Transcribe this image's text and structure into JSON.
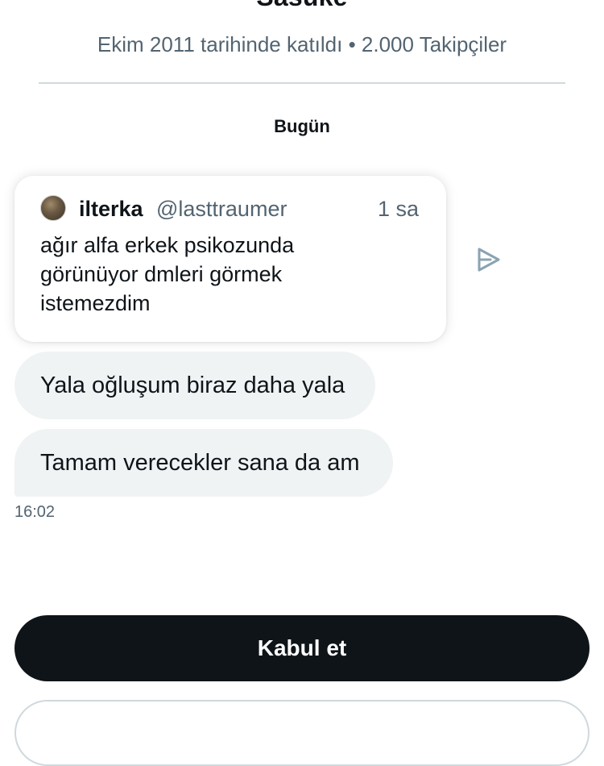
{
  "profile": {
    "name": "Sasuke",
    "meta": "Ekim 2011 tarihinde katıldı • 2.000 Takipçiler"
  },
  "conversation": {
    "day_label": "Bugün",
    "quoted_post": {
      "author_name": "ilterka",
      "author_handle": "@lasttraumer",
      "time": "1 sa",
      "text": "ağır alfa erkek psikozunda görünüyor dmleri görmek istemezdim"
    },
    "messages": [
      {
        "text": "Yala oğluşum biraz daha yala"
      },
      {
        "text": "Tamam verecekler sana da am"
      }
    ],
    "last_message_time": "16:02"
  },
  "actions": {
    "accept_label": "Kabul et"
  },
  "icons": {
    "share": "share-arrow-icon",
    "avatar": "avatar"
  },
  "colors": {
    "text_primary": "#0f1419",
    "text_secondary": "#536471",
    "bubble_bg": "#eff3f4",
    "divider": "#cfd9de",
    "button_bg": "#0f1419"
  }
}
